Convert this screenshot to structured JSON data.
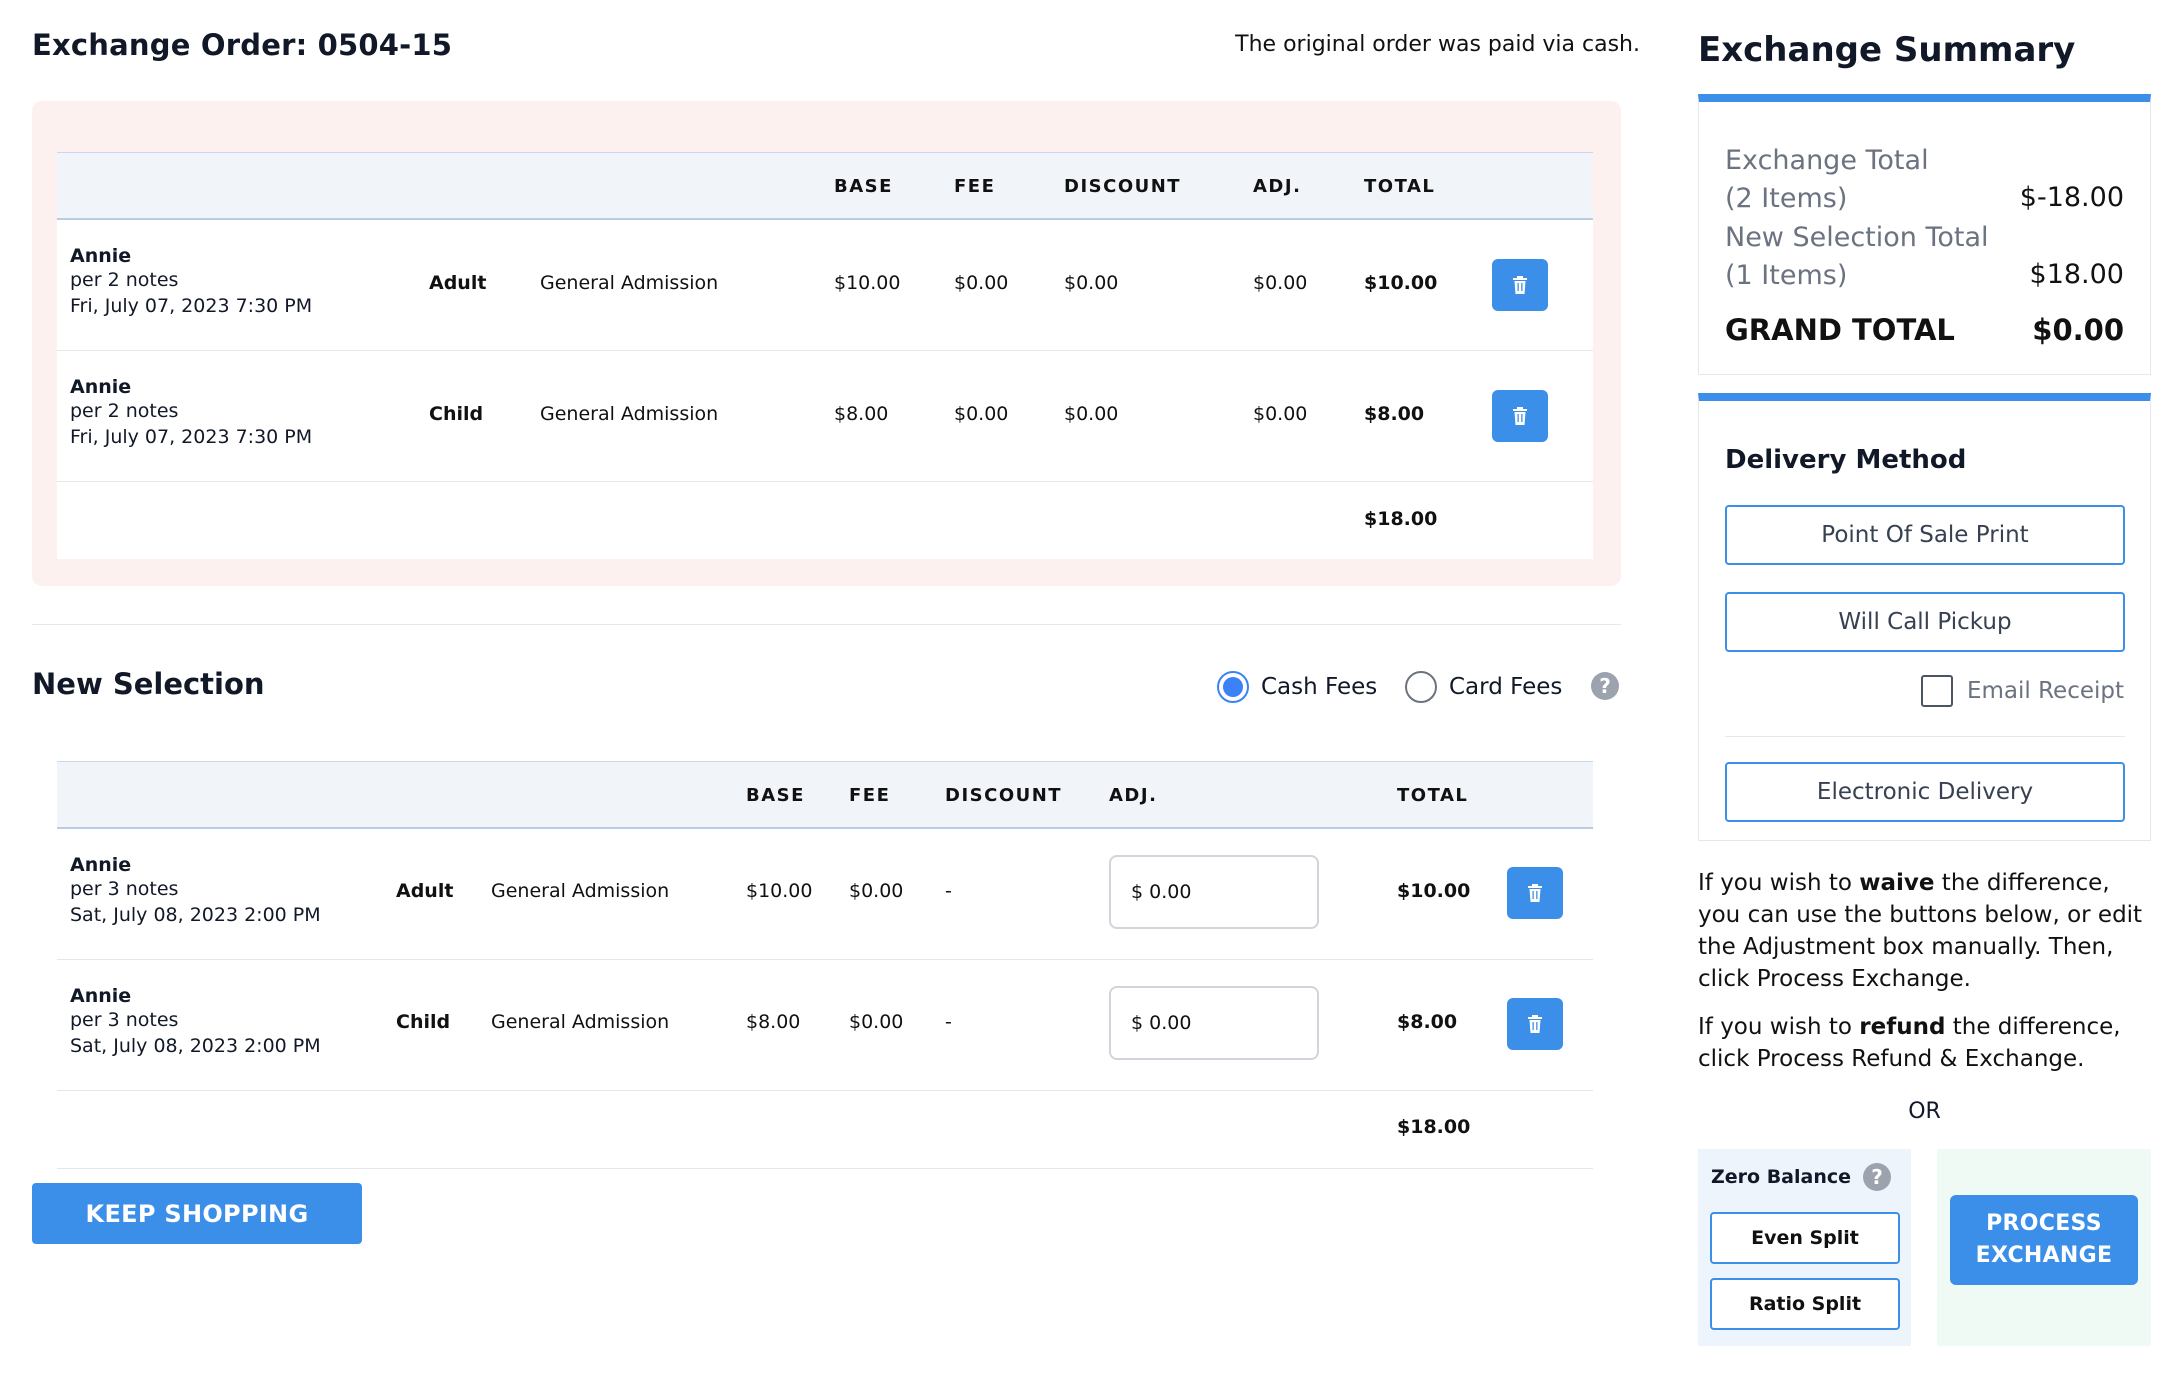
{
  "header": {
    "order_title": "Exchange Order: 0504-15",
    "paid_note": "The original order was paid via cash."
  },
  "original_table": {
    "columns": [
      "BASE",
      "FEE",
      "DISCOUNT",
      "ADJ.",
      "TOTAL"
    ],
    "rows": [
      {
        "name": "Annie",
        "notes": "per 2 notes",
        "date": "Fri, July 07, 2023 7:30 PM",
        "type": "Adult",
        "section": "General Admission",
        "base": "$10.00",
        "fee": "$0.00",
        "discount": "$0.00",
        "adj": "$0.00",
        "total": "$10.00"
      },
      {
        "name": "Annie",
        "notes": "per 2 notes",
        "date": "Fri, July 07, 2023 7:30 PM",
        "type": "Child",
        "section": "General Admission",
        "base": "$8.00",
        "fee": "$0.00",
        "discount": "$0.00",
        "adj": "$0.00",
        "total": "$8.00"
      }
    ],
    "sum_total": "$18.00"
  },
  "new_selection": {
    "title": "New Selection",
    "cash_fees_label": "Cash Fees",
    "card_fees_label": "Card Fees",
    "selected_fee_mode": "cash",
    "help_glyph": "?",
    "columns": [
      "BASE",
      "FEE",
      "DISCOUNT",
      "ADJ.",
      "TOTAL"
    ],
    "rows": [
      {
        "name": "Annie",
        "notes": "per 3 notes",
        "date": "Sat, July 08, 2023 2:00 PM",
        "type": "Adult",
        "section": "General Admission",
        "base": "$10.00",
        "fee": "$0.00",
        "discount": "-",
        "adj_value": "$ 0.00",
        "total": "$10.00"
      },
      {
        "name": "Annie",
        "notes": "per 3 notes",
        "date": "Sat, July 08, 2023 2:00 PM",
        "type": "Child",
        "section": "General Admission",
        "base": "$8.00",
        "fee": "$0.00",
        "discount": "-",
        "adj_value": "$ 0.00",
        "total": "$8.00"
      }
    ],
    "sum_total": "$18.00",
    "keep_shopping_label": "KEEP SHOPPING"
  },
  "summary": {
    "title": "Exchange Summary",
    "exchange_total_label_1": "Exchange Total",
    "exchange_total_label_2": "(2 Items)",
    "exchange_total_value": "$-18.00",
    "new_selection_label_1": "New Selection Total",
    "new_selection_label_2": "(1 Items)",
    "new_selection_value": "$18.00",
    "grand_total_label": "GRAND TOTAL",
    "grand_total_value": "$0.00"
  },
  "delivery": {
    "title": "Delivery Method",
    "pos_print": "Point Of Sale Print",
    "will_call": "Will Call Pickup",
    "email_receipt": "Email Receipt",
    "electronic": "Electronic Delivery"
  },
  "instructions": {
    "waive_pre": "If you wish to ",
    "waive_bold": "waive",
    "waive_post": " the difference, you can use the buttons below, or edit the Adjustment box manually. Then, click Process Exchange.",
    "refund_pre": "If you wish to ",
    "refund_bold": "refund",
    "refund_post": " the difference, click Process Refund & Exchange.",
    "or": "OR"
  },
  "actions": {
    "zero_balance": "Zero Balance",
    "even_split": "Even Split",
    "ratio_split": "Ratio Split",
    "process_line1": "PROCESS",
    "process_line2": "EXCHANGE"
  },
  "colors": {
    "accent": "#3b8fe8",
    "original_panel_bg": "#fdf1f0",
    "zero_box_bg": "#eef4fc",
    "process_box_bg": "#eefaf3"
  }
}
